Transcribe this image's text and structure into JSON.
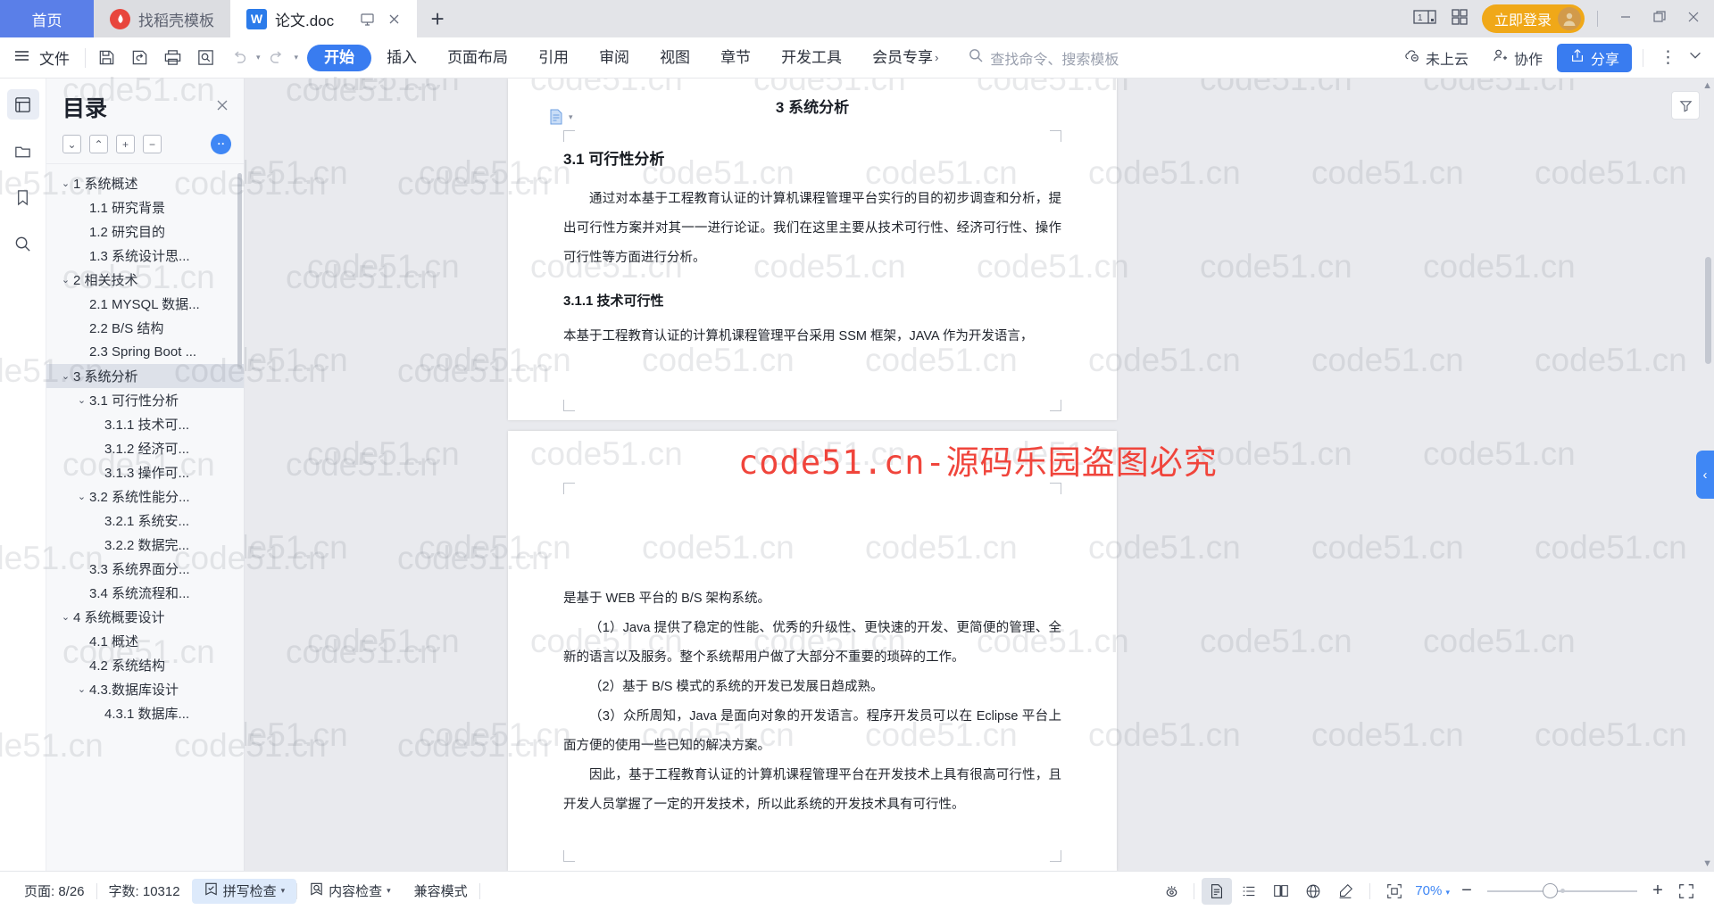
{
  "tabbar": {
    "home_label": "首页",
    "tabs": [
      {
        "label": "找稻壳模板",
        "icon": "docer-icon"
      },
      {
        "label": "论文.doc",
        "icon": "wps-writer-icon"
      }
    ],
    "new_tab": "+",
    "login_label": "立即登录",
    "page_count_badge": "1"
  },
  "ribbon": {
    "file_label": "文件",
    "tabs": [
      {
        "label": "开始",
        "active": true
      },
      {
        "label": "插入",
        "active": false
      },
      {
        "label": "页面布局",
        "active": false
      },
      {
        "label": "引用",
        "active": false
      },
      {
        "label": "审阅",
        "active": false
      },
      {
        "label": "视图",
        "active": false
      },
      {
        "label": "章节",
        "active": false
      },
      {
        "label": "开发工具",
        "active": false
      },
      {
        "label": "会员专享",
        "active": false
      }
    ],
    "search_placeholder": "查找命令、搜索模板",
    "cloud_label": "未上云",
    "collab_label": "协作",
    "share_label": "分享"
  },
  "toc": {
    "title": "目录",
    "items": [
      {
        "label": "1 系统概述",
        "level": 1,
        "arrow": "down",
        "selected": false
      },
      {
        "label": "1.1  研究背景",
        "level": 2,
        "arrow": "none",
        "selected": false
      },
      {
        "label": "1.2 研究目的",
        "level": 2,
        "arrow": "none",
        "selected": false
      },
      {
        "label": "1.3 系统设计思...",
        "level": 2,
        "arrow": "none",
        "selected": false
      },
      {
        "label": "2 相关技术",
        "level": 1,
        "arrow": "down",
        "selected": false
      },
      {
        "label": "2.1 MYSQL 数据...",
        "level": 2,
        "arrow": "none",
        "selected": false
      },
      {
        "label": "2.2 B/S 结构",
        "level": 2,
        "arrow": "none",
        "selected": false
      },
      {
        "label": "2.3 Spring Boot ...",
        "level": 2,
        "arrow": "none",
        "selected": false
      },
      {
        "label": "3 系统分析",
        "level": 1,
        "arrow": "down",
        "selected": true
      },
      {
        "label": "3.1 可行性分析",
        "level": 2,
        "arrow": "down",
        "selected": false
      },
      {
        "label": "3.1.1 技术可...",
        "level": 3,
        "arrow": "none",
        "selected": false
      },
      {
        "label": "3.1.2 经济可...",
        "level": 3,
        "arrow": "none",
        "selected": false
      },
      {
        "label": "3.1.3 操作可...",
        "level": 3,
        "arrow": "none",
        "selected": false
      },
      {
        "label": "3.2 系统性能分...",
        "level": 2,
        "arrow": "down",
        "selected": false
      },
      {
        "label": "3.2.1 系统安...",
        "level": 3,
        "arrow": "none",
        "selected": false
      },
      {
        "label": "3.2.2 数据完...",
        "level": 3,
        "arrow": "none",
        "selected": false
      },
      {
        "label": "3.3 系统界面分...",
        "level": 2,
        "arrow": "none",
        "selected": false
      },
      {
        "label": "3.4 系统流程和...",
        "level": 2,
        "arrow": "none",
        "selected": false
      },
      {
        "label": "4 系统概要设计",
        "level": 1,
        "arrow": "down",
        "selected": false
      },
      {
        "label": "4.1 概述",
        "level": 2,
        "arrow": "none",
        "selected": false
      },
      {
        "label": "4.2 系统结构",
        "level": 2,
        "arrow": "none",
        "selected": false
      },
      {
        "label": "4.3.数据库设计",
        "level": 2,
        "arrow": "down",
        "selected": false
      },
      {
        "label": "4.3.1 数据库...",
        "level": 3,
        "arrow": "none",
        "selected": false
      }
    ]
  },
  "document": {
    "header": "3 系统分析",
    "page1": {
      "h2": "3.1 可行性分析",
      "p1": "通过对本基于工程教育认证的计算机课程管理平台实行的目的初步调查和分析，提出可行性方案并对其一一进行论证。我们在这里主要从技术可行性、经济可行性、操作可行性等方面进行分析。",
      "h3": "3.1.1 技术可行性",
      "p2": "本基于工程教育认证的计算机课程管理平台采用 SSM 框架，JAVA 作为开发语言，"
    },
    "page2": {
      "p1": "是基于 WEB 平台的 B/S 架构系统。",
      "p2": "（1）Java 提供了稳定的性能、优秀的升级性、更快速的开发、更简便的管理、全新的语言以及服务。整个系统帮用户做了大部分不重要的琐碎的工作。",
      "p3": "（2）基于 B/S 模式的系统的开发已发展日趋成熟。",
      "p4": "（3）众所周知，Java 是面向对象的开发语言。程序开发员可以在 Eclipse 平台上面方便的使用一些已知的解决方案。",
      "p5": "因此，基于工程教育认证的计算机课程管理平台在开发技术上具有很高可行性，且开发人员掌握了一定的开发技术，所以此系统的开发技术具有可行性。"
    }
  },
  "watermark": {
    "text": "code51.cn",
    "red_text": "code51.cn-源码乐园盗图必究",
    "red_color": "#f0453c"
  },
  "status": {
    "pages_label": "页面: 8/26",
    "words_label": "字数: 10312",
    "spellcheck_label": "拼写检查",
    "contentcheck_label": "内容检查",
    "compat_label": "兼容模式",
    "zoom_label": "70%",
    "zoom_minus": "−",
    "zoom_plus": "+"
  },
  "colors": {
    "accent": "#397cf0",
    "home_tab": "#5a7fe8",
    "login": "#f0a818",
    "watermark_red": "#f0453c"
  }
}
